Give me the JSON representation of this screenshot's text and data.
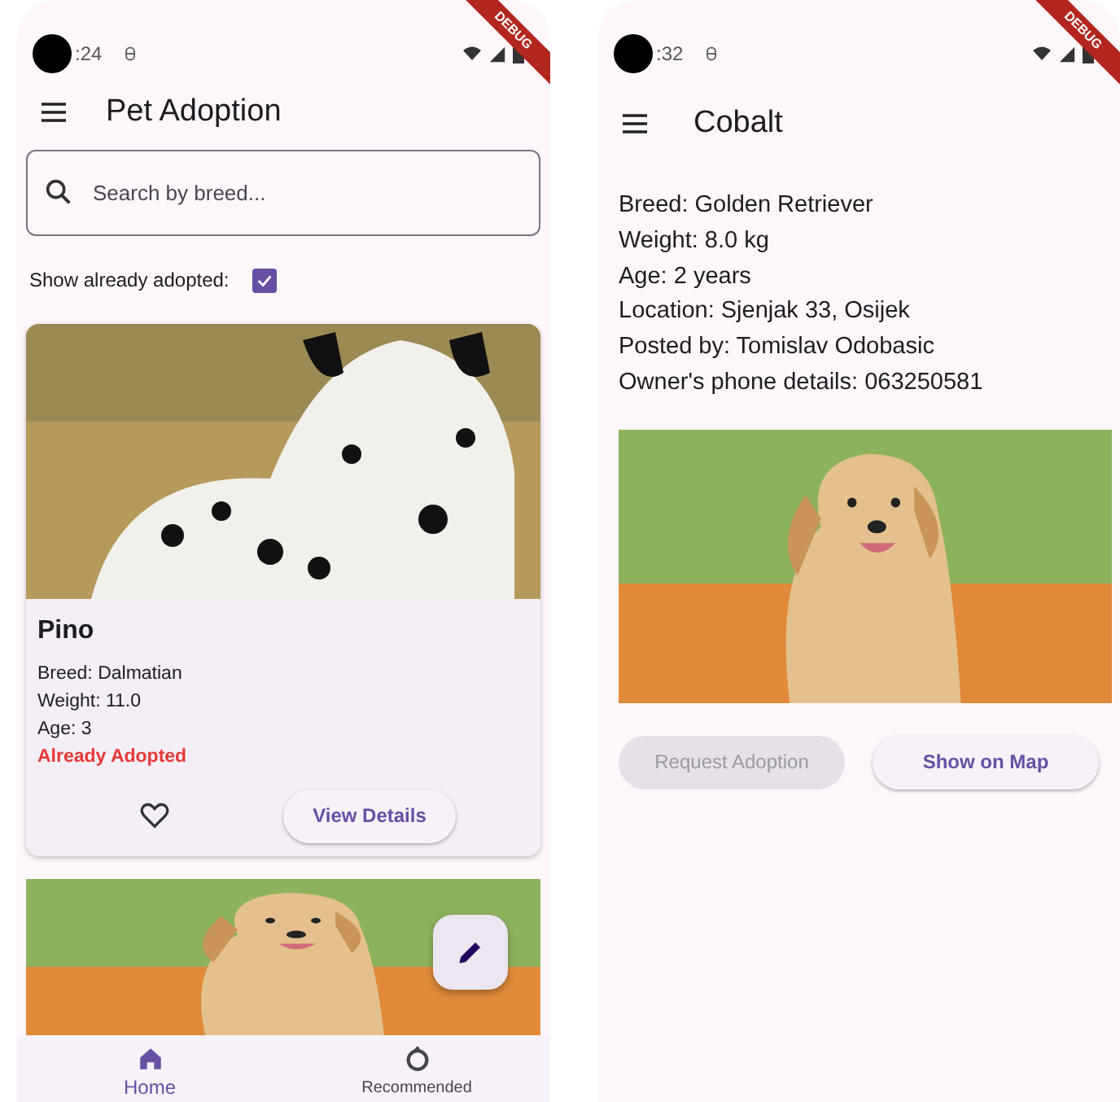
{
  "list_screen": {
    "status_bar": {
      "time": ":24"
    },
    "debug_banner": "DEBUG",
    "app_bar": {
      "title": "Pet Adoption"
    },
    "search": {
      "placeholder": "Search by breed..."
    },
    "filter": {
      "label": "Show already adopted:",
      "checked": true
    },
    "pets": [
      {
        "kind": "full_card",
        "name": "Pino",
        "details": [
          "Breed: Dalmatian",
          "Weight: 11.0",
          "Age: 3"
        ],
        "status": "Already Adopted",
        "favorite": false,
        "button": "View Details"
      },
      {
        "kind": "photo_only"
      }
    ],
    "bottom_nav": [
      {
        "label": "Home",
        "selected": true
      },
      {
        "label": "Recommended",
        "selected": false
      }
    ]
  },
  "detail_screen": {
    "status_bar": {
      "time": ":32"
    },
    "debug_banner": "DEBUG",
    "app_bar": {
      "title": "Cobalt"
    },
    "details": [
      "Breed: Golden Retriever",
      "Weight: 8.0 kg",
      "Age: 2 years",
      "Location: Sjenjak 33, Osijek",
      "Posted by: Tomislav Odobasic",
      "Owner's phone details: 063250581"
    ],
    "buttons": [
      {
        "label": "Request Adoption",
        "disabled": true
      },
      {
        "label": "Show on Map",
        "disabled": false
      }
    ]
  }
}
